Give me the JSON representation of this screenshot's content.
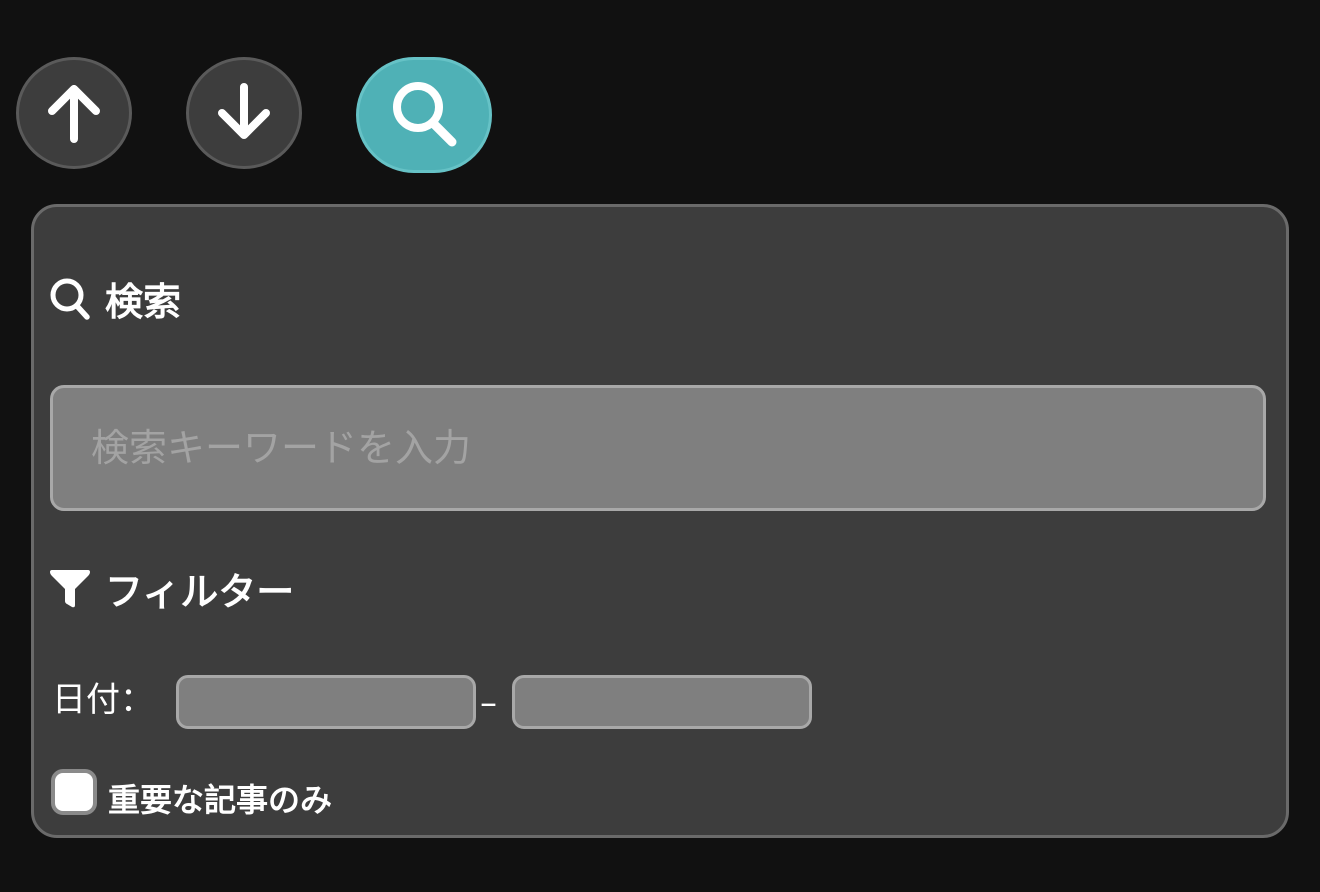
{
  "toolbar": {
    "up_icon": "arrow-up-icon",
    "down_icon": "arrow-down-icon",
    "search_icon": "search-icon",
    "search_active_color": "#4fb1b6"
  },
  "panel": {
    "search_section": {
      "title": "検索",
      "icon": "search-icon",
      "input_placeholder": "検索キーワードを入力",
      "input_value": ""
    },
    "filter_section": {
      "title": "フィルター",
      "icon": "filter-icon",
      "date_label": "日付：",
      "date_from_value": "",
      "date_separator": "–",
      "date_to_value": "",
      "important_only_label": "重要な記事のみ",
      "important_only_checked": false
    }
  },
  "colors": {
    "background": "#111111",
    "panel": "#3d3d3d",
    "accent": "#4fb1b6",
    "input": "#7f7f7f"
  }
}
